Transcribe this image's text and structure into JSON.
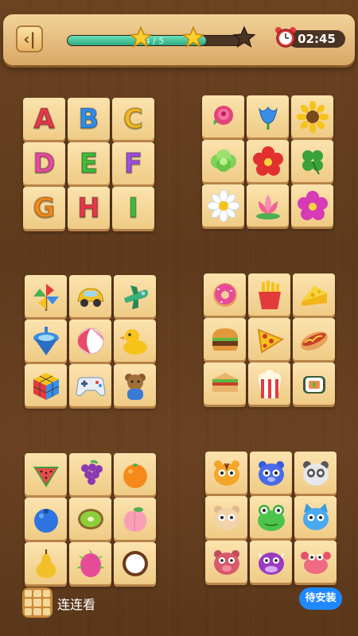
{
  "header": {
    "progress_text": "4 / 5",
    "progress_fraction": 0.8,
    "stars_earned": 2,
    "stars_total": 3,
    "timer": "02:45"
  },
  "board": {
    "letters": [
      "A",
      "B",
      "C",
      "D",
      "E",
      "F",
      "G",
      "H",
      "I"
    ],
    "letter_colors": [
      "#e8374a",
      "#2e8ef0",
      "#f0b91f",
      "#e64a9f",
      "#3fbf3a",
      "#a14ee0",
      "#f08a1f",
      "#e8374a",
      "#3fbf3a"
    ],
    "flowers": [
      "rose-icon",
      "tulip-icon",
      "sunflower-icon",
      "cabbage-icon",
      "red-flower-icon",
      "clover-icon",
      "daisy-icon",
      "lotus-icon",
      "pink-flower-icon"
    ],
    "toys": [
      "pinwheel-icon",
      "toy-car-icon",
      "toy-plane-icon",
      "spinning-top-icon",
      "beach-ball-icon",
      "rubber-duck-icon",
      "rubiks-cube-icon",
      "gamepad-icon",
      "teddy-icon"
    ],
    "foods": [
      "donut-icon",
      "fries-icon",
      "cheese-icon",
      "burger-icon",
      "pizza-icon",
      "hotdog-icon",
      "sandwich-icon",
      "popcorn-icon",
      "sushi-icon"
    ],
    "fruits": [
      "watermelon-icon",
      "grapes-icon",
      "orange-icon",
      "blueberry-icon",
      "kiwi-icon",
      "peach-icon",
      "pear-icon",
      "dragonfruit-icon",
      "coconut-icon"
    ],
    "animals": [
      "tiger-icon",
      "bear-icon",
      "panda-icon",
      "hamster-icon",
      "frog-icon",
      "cat-icon",
      "pig-icon",
      "cow-icon",
      "crab-icon"
    ]
  },
  "footer": {
    "app_name": "连连看",
    "install_label": "待安装"
  }
}
